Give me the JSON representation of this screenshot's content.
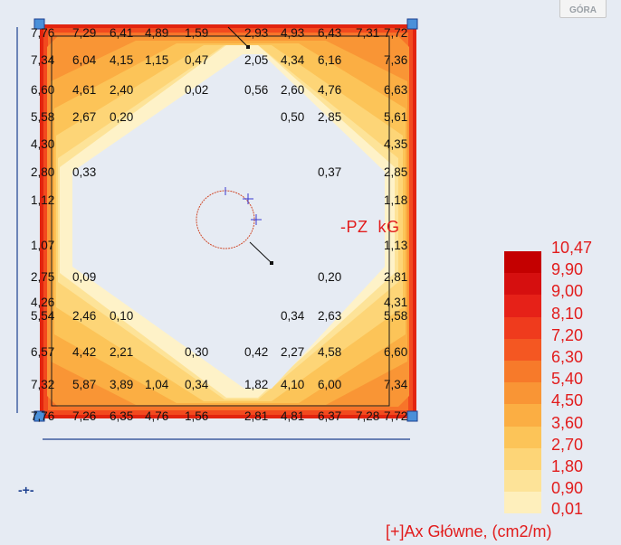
{
  "toolbar": {
    "view_button_label": "GÓRA"
  },
  "load_label": "-PZ  kG",
  "result_title": "[+]Ax Główne, (cm2/m)",
  "legend": {
    "values": [
      "10,47",
      "9,90",
      "9,00",
      "8,10",
      "7,20",
      "6,30",
      "5,40",
      "4,50",
      "3,60",
      "2,70",
      "1,80",
      "0,90",
      "0,01"
    ],
    "colors": [
      "#c40000",
      "#d60f0f",
      "#e62118",
      "#ef3b1d",
      "#f45722",
      "#f77a2a",
      "#f99535",
      "#fbae43",
      "#fcc458",
      "#fdd577",
      "#fde398",
      "#feefbc"
    ]
  },
  "grid_values": {
    "rows": [
      [
        "7,76",
        "7,29",
        "6,41",
        "4,89",
        "1,59",
        "",
        "",
        "",
        "2,93",
        "4,93",
        "6,43",
        "7,31",
        "7,72"
      ],
      [
        "7,34",
        "6,04",
        "4,15",
        "1,15",
        "0,47",
        "",
        "",
        "",
        "2,05",
        "4,34",
        "6,16",
        "",
        "7,36"
      ],
      [
        "6,60",
        "4,61",
        "2,40",
        "",
        "0,02",
        "",
        "",
        "",
        "0,56",
        "2,60",
        "4,76",
        "",
        "6,63"
      ],
      [
        "5,58",
        "2,67",
        "0,20",
        "",
        "",
        "",
        "",
        "",
        "",
        "0,50",
        "2,85",
        "",
        "5,61"
      ],
      [
        "4,30",
        "",
        "",
        "",
        "",
        "",
        "",
        "",
        "",
        "",
        "",
        "",
        "4,35"
      ],
      [
        "2,80",
        "0,33",
        "",
        "",
        "",
        "",
        "",
        "",
        "",
        "",
        "0,37",
        "",
        "2,85"
      ],
      [
        "1,12",
        "",
        "",
        "",
        "",
        "",
        "",
        "",
        "",
        "",
        "",
        "",
        "1,18"
      ],
      [
        "1,07",
        "",
        "",
        "",
        "",
        "",
        "",
        "",
        "",
        "",
        "",
        "",
        "1,13"
      ],
      [
        "2,75",
        "0,09",
        "",
        "",
        "",
        "",
        "",
        "",
        "",
        "",
        "0,20",
        "",
        "2,81"
      ],
      [
        "4,26",
        "",
        "",
        "",
        "",
        "",
        "",
        "",
        "",
        "",
        "",
        "",
        "4,31"
      ],
      [
        "5,54",
        "2,46",
        "0,10",
        "",
        "",
        "",
        "",
        "",
        "",
        "0,34",
        "2,63",
        "",
        "5,58"
      ],
      [
        "6,57",
        "4,42",
        "2,21",
        "",
        "0,30",
        "",
        "",
        "",
        "0,42",
        "2,27",
        "4,58",
        "",
        "6,60"
      ],
      [
        "7,32",
        "5,87",
        "3,89",
        "1,04",
        "0,34",
        "",
        "",
        "",
        "1,82",
        "4,10",
        "6,00",
        "",
        "7,34"
      ],
      [
        "7,76",
        "7,26",
        "6,35",
        "4,76",
        "1,56",
        "",
        "",
        "",
        "2,81",
        "4,81",
        "6,37",
        "7,28",
        "7,72"
      ]
    ]
  },
  "axis_mark": "-+-"
}
